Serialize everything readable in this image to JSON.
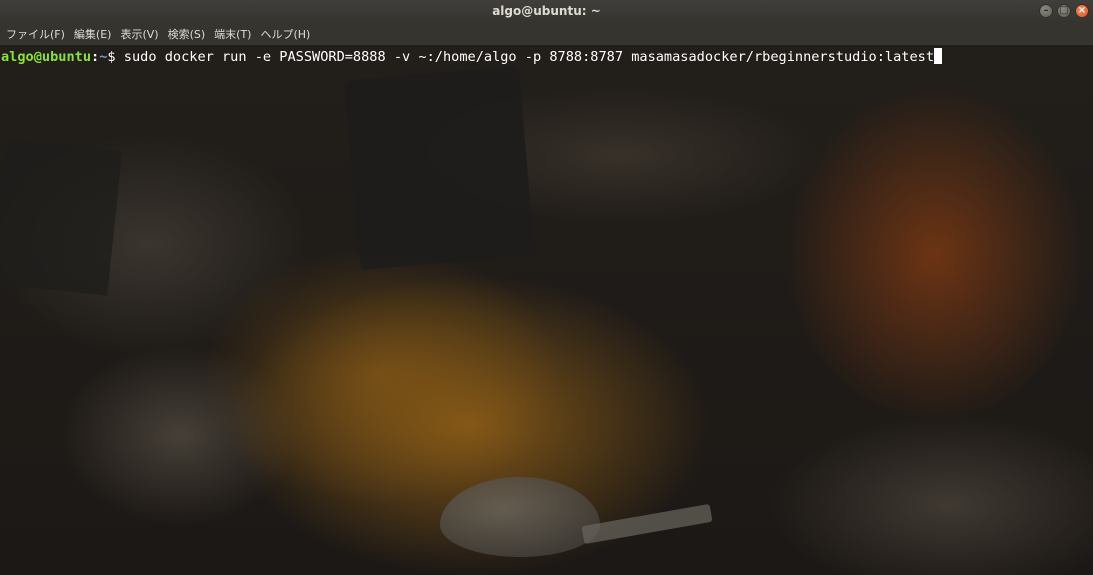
{
  "window": {
    "title": "algo@ubuntu: ~",
    "minimize_glyph": "–",
    "maximize_glyph": "□",
    "close_glyph": "×"
  },
  "menu": {
    "items": [
      {
        "label": "ファイル(F)"
      },
      {
        "label": "編集(E)"
      },
      {
        "label": "表示(V)"
      },
      {
        "label": "検索(S)"
      },
      {
        "label": "端末(T)"
      },
      {
        "label": "ヘルプ(H)"
      }
    ]
  },
  "terminal": {
    "prompt_user_host": "algo@ubuntu",
    "prompt_separator": ":",
    "prompt_path": "~",
    "prompt_symbol": "$ ",
    "command": "sudo docker run -e PASSWORD=8888 -v ~:/home/algo -p 8788:8787 masamasadocker/rbeginnerstudio:latest",
    "colors": {
      "user_host": "#8ae234",
      "path": "#729fcf",
      "text": "#ffffff"
    }
  }
}
